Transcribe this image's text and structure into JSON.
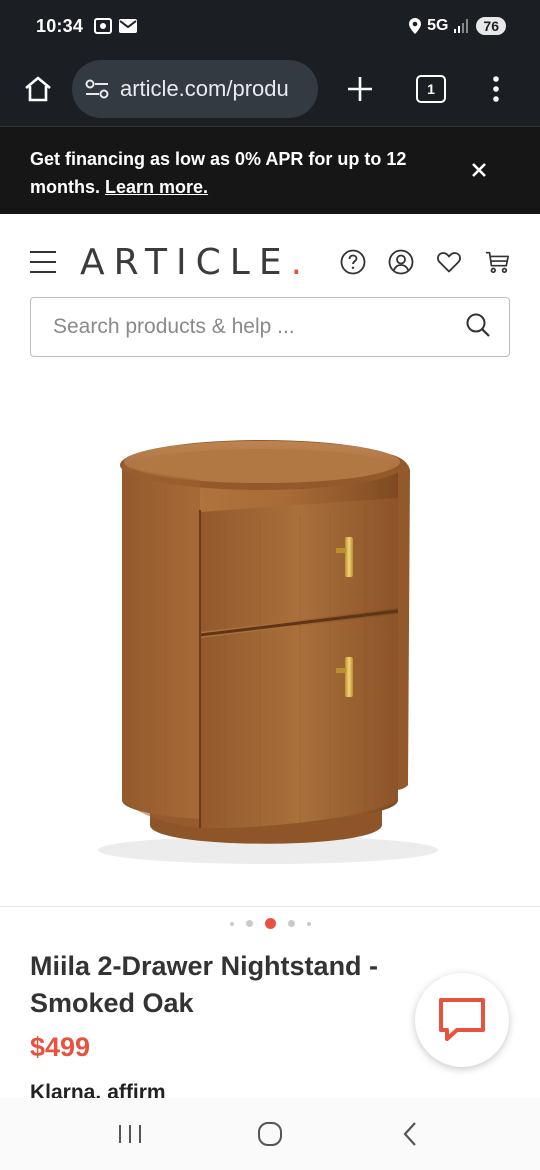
{
  "status_bar": {
    "time": "10:34",
    "network": "5G",
    "battery": "76"
  },
  "browser": {
    "url": "article.com/produ",
    "tab_count": "1"
  },
  "promo": {
    "text": "Get financing as low as 0% APR for up to 12 months.",
    "link": "Learn more."
  },
  "header": {
    "logo": "ARTICLE",
    "logo_dot": "."
  },
  "search": {
    "placeholder": "Search products & help ..."
  },
  "carousel": {
    "total": 5,
    "active_index": 2
  },
  "product": {
    "title": "Miila 2-Drawer Nightstand - Smoked Oak",
    "price": "$499"
  },
  "payment": {
    "klarna": "Klarna.",
    "affirm": "affirm"
  },
  "colors": {
    "accent": "#e8533f",
    "dark": "#161616",
    "wood": "#a5693a"
  }
}
